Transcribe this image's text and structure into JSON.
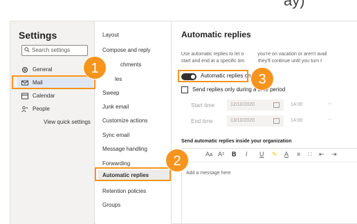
{
  "settings": {
    "title": "Settings",
    "search_placeholder": "Search settings",
    "items": [
      {
        "label": "General",
        "icon": "gear-icon"
      },
      {
        "label": "Mail",
        "icon": "mail-icon"
      },
      {
        "label": "Calendar",
        "icon": "calendar-icon"
      },
      {
        "label": "People",
        "icon": "people-icon"
      }
    ],
    "quick": "View quick settings"
  },
  "menu": {
    "items": [
      "Layout",
      "Compose and reply",
      "Attachments",
      "Rules",
      "Sweep",
      "Junk email",
      "Customize actions",
      "Sync email",
      "Message handling",
      "Forwarding",
      "Automatic replies",
      "Retention policies",
      "Groups"
    ],
    "visible": [
      "Layout",
      "Compose and reply",
      "chments",
      "les",
      "Sweep",
      "Junk email",
      "Customize actions",
      "Sync email",
      "Message handling",
      "Forwarding",
      "Automatic replies",
      "Retention policies",
      "Groups"
    ]
  },
  "main": {
    "title": "Automatic replies",
    "desc_line1": "Use automatic replies to let o",
    "desc_line1b": "you're on vacation or aren't avail",
    "desc_line2": "start and end at a specific tim",
    "desc_line2b": "they'll continue until you turn t",
    "toggle_label": "Automatic replies on",
    "checkbox_label": "Send replies only during a time period",
    "start_label": "Start time",
    "start_date": "12/10/2020",
    "start_time": "14:00",
    "end_label": "End time",
    "end_date": "13/10/2020",
    "end_time": "14:00",
    "section_head": "Send automatic replies inside your organization",
    "placeholder": "Add a message here"
  },
  "badges": [
    "1",
    "2",
    "3"
  ],
  "colors": {
    "accent": "#f7941d",
    "toggle": "#323130",
    "selected": "#dfe6f3"
  }
}
